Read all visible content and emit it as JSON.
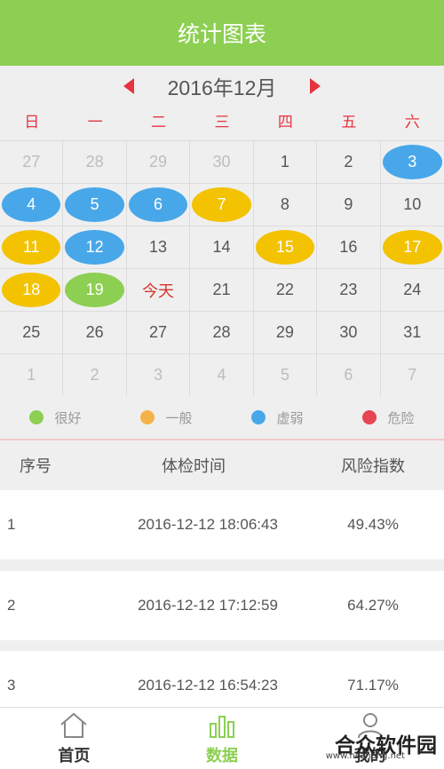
{
  "header": {
    "title": "统计图表"
  },
  "calendar": {
    "month": "2016年12月",
    "weekdays": [
      "日",
      "一",
      "二",
      "三",
      "四",
      "五",
      "六"
    ],
    "colors": {
      "good": "#8ccf52",
      "normal": "#f3c200",
      "weak": "#48a7e9",
      "danger": "#e64552"
    },
    "cells": [
      {
        "t": "27",
        "other": true
      },
      {
        "t": "28",
        "other": true
      },
      {
        "t": "29",
        "other": true
      },
      {
        "t": "30",
        "other": true
      },
      {
        "t": "1"
      },
      {
        "t": "2"
      },
      {
        "t": "3",
        "s": "weak"
      },
      {
        "t": "4",
        "s": "weak"
      },
      {
        "t": "5",
        "s": "weak"
      },
      {
        "t": "6",
        "s": "weak"
      },
      {
        "t": "7",
        "s": "normal"
      },
      {
        "t": "8"
      },
      {
        "t": "9"
      },
      {
        "t": "10"
      },
      {
        "t": "11",
        "s": "normal"
      },
      {
        "t": "12",
        "s": "weak"
      },
      {
        "t": "13"
      },
      {
        "t": "14"
      },
      {
        "t": "15",
        "s": "normal"
      },
      {
        "t": "16"
      },
      {
        "t": "17",
        "s": "normal"
      },
      {
        "t": "18",
        "s": "normal"
      },
      {
        "t": "19",
        "s": "good"
      },
      {
        "t": "今天",
        "today": true
      },
      {
        "t": "21"
      },
      {
        "t": "22"
      },
      {
        "t": "23"
      },
      {
        "t": "24"
      },
      {
        "t": "25"
      },
      {
        "t": "26"
      },
      {
        "t": "27"
      },
      {
        "t": "28"
      },
      {
        "t": "29"
      },
      {
        "t": "30"
      },
      {
        "t": "31"
      },
      {
        "t": "1",
        "other": true
      },
      {
        "t": "2",
        "other": true
      },
      {
        "t": "3",
        "other": true
      },
      {
        "t": "4",
        "other": true
      },
      {
        "t": "5",
        "other": true
      },
      {
        "t": "6",
        "other": true
      },
      {
        "t": "7",
        "other": true
      }
    ]
  },
  "legend": [
    {
      "label": "很好",
      "color": "#8ccf52"
    },
    {
      "label": "一般",
      "color": "#f6b24a"
    },
    {
      "label": "虚弱",
      "color": "#48a7e9"
    },
    {
      "label": "危险",
      "color": "#e64552"
    }
  ],
  "table": {
    "headers": [
      "序号",
      "体检时间",
      "风险指数"
    ],
    "rows": [
      [
        "1",
        "2016-12-12 18:06:43",
        "49.43%"
      ],
      [
        "2",
        "2016-12-12 17:12:59",
        "64.27%"
      ],
      [
        "3",
        "2016-12-12 16:54:23",
        "71.17%"
      ]
    ]
  },
  "tabbar": {
    "home": "首页",
    "data": "数据",
    "mine": "我的"
  },
  "watermark": {
    "main": "合众软件园",
    "sub": "www.hezhong.net"
  }
}
